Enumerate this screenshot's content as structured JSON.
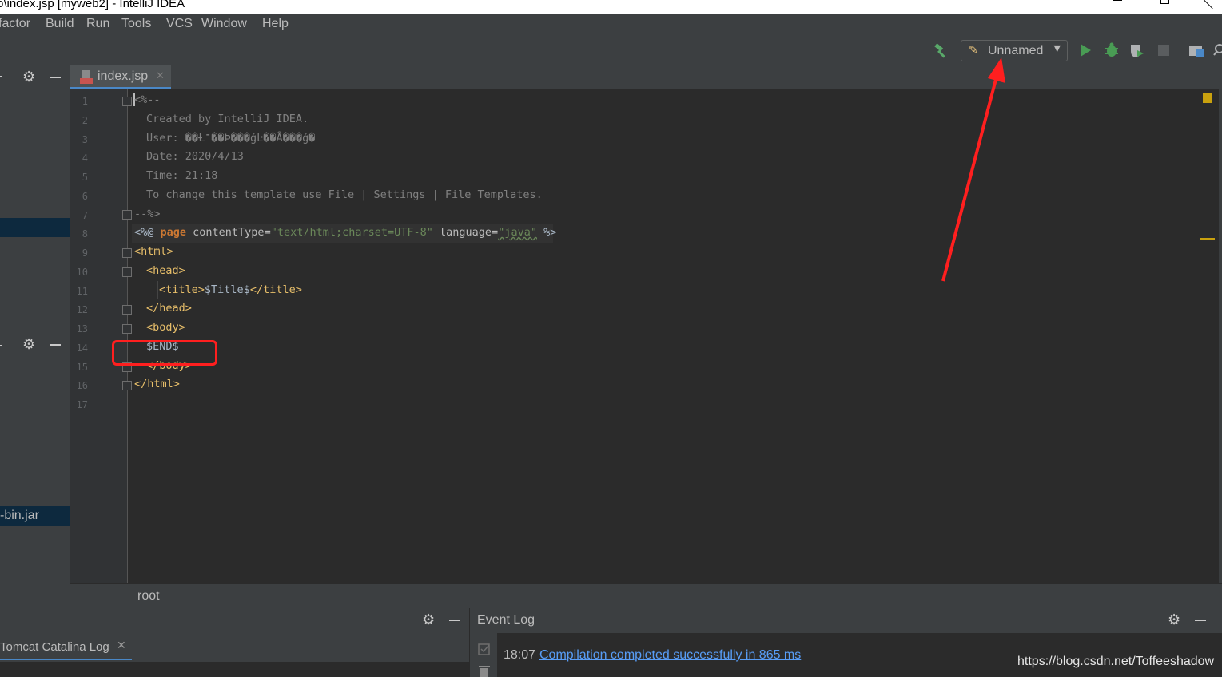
{
  "window": {
    "title": "o\\index.jsp [myweb2] - IntelliJ IDEA"
  },
  "menu": [
    "factor",
    "Build",
    "Run",
    "Tools",
    "VCS",
    "Window",
    "Help"
  ],
  "toolbar": {
    "run_config": "Unnamed"
  },
  "left_panel": {
    "jar_item": "-bin.jar"
  },
  "editor": {
    "tab_label": "index.jsp",
    "line_numbers": [
      "1",
      "2",
      "3",
      "4",
      "5",
      "6",
      "7",
      "8",
      "9",
      "10",
      "11",
      "12",
      "13",
      "14",
      "15",
      "16",
      "17"
    ],
    "lines": {
      "l1": "<%--",
      "l2": "Created by IntelliJ IDEA.",
      "l3_label": "User: ",
      "l3_value": "��Ƚ־��Ϸ���ǵĿ��Ȃ���ǵ�",
      "l4": "Date: 2020/4/13",
      "l5": "Time: 21:18",
      "l6": "To change this template use File | Settings | File Templates.",
      "l7": "--%>",
      "l8": {
        "open": "<%@ ",
        "kw": "page",
        "attr1": " contentType=",
        "val1": "\"text/html;charset=UTF-8\"",
        "attr2": " language=",
        "val2": "\"java\"",
        "close": " %>"
      },
      "l9": "<html>",
      "l10": "<head>",
      "l11_open": "<title>",
      "l11_text": "$Title$",
      "l11_close": "</title>",
      "l12": "</head>",
      "l13": "<body>",
      "l14": "$END$",
      "l15": "</body>",
      "l16": "</html>"
    },
    "breadcrumb": "root"
  },
  "bottom_left": {
    "tab_label": "Tomcat Catalina Log"
  },
  "event_log": {
    "title": "Event Log",
    "time": "18:07",
    "message": "Compilation completed successfully in 865 ms"
  },
  "watermark": "https://blog.csdn.net/Toffeeshadow",
  "colors": {
    "annotation": "#ff1f1f",
    "link": "#589df6",
    "tag": "#e8bf6a",
    "keyword": "#cc7832",
    "string": "#6a8759"
  }
}
